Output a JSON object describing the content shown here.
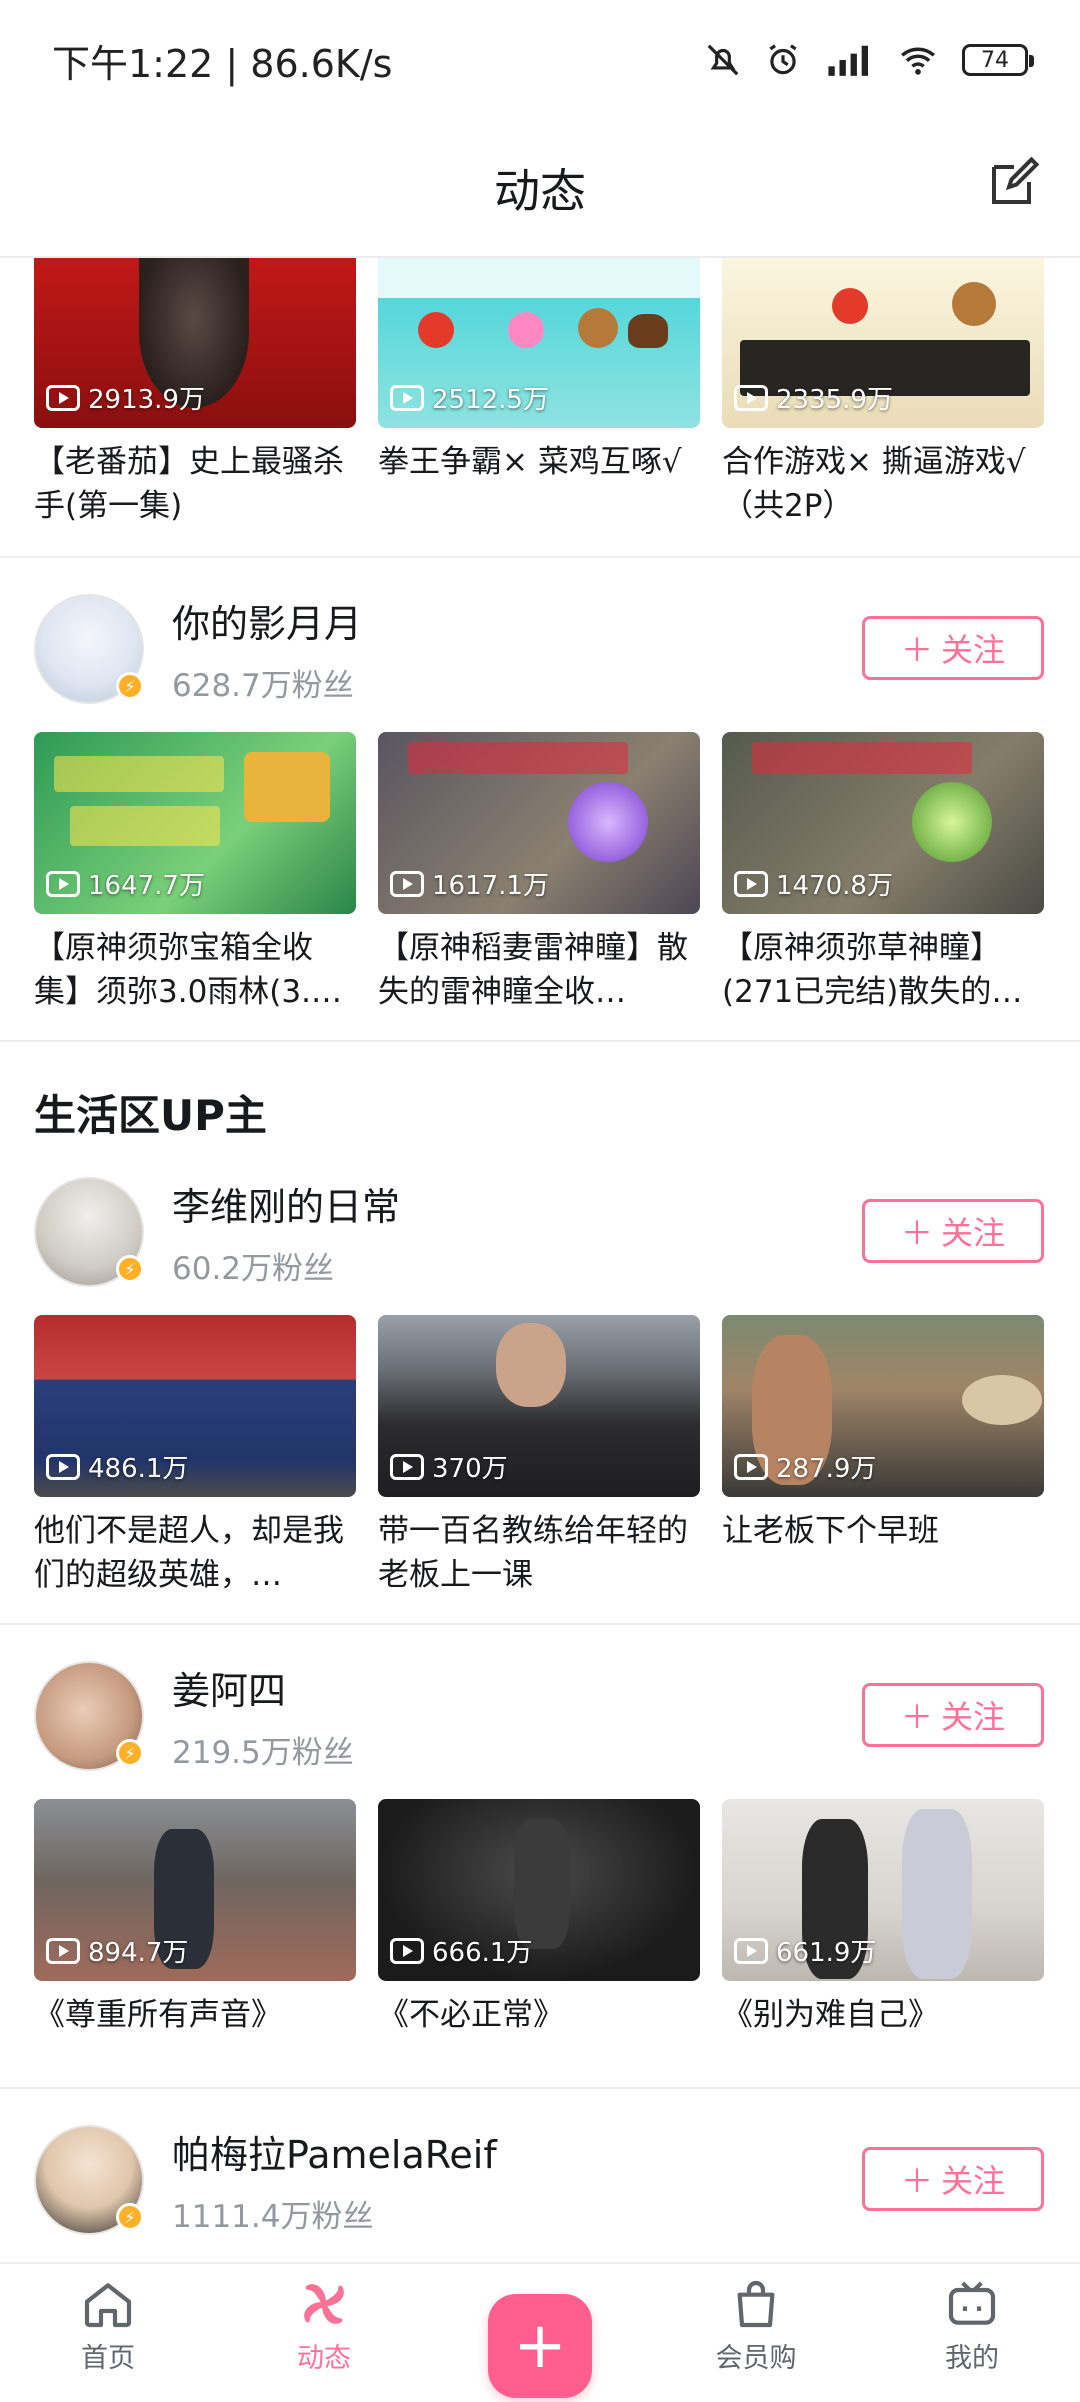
{
  "status": {
    "time_speed": "下午1:22 | 86.6K/s",
    "battery": "74"
  },
  "header": {
    "title": "动态"
  },
  "top_videos": [
    {
      "views": "2913.9万",
      "title": "【老番茄】史上最骚杀手(第一集)"
    },
    {
      "views": "2512.5万",
      "title": "拳王争霸× 菜鸡互啄√"
    },
    {
      "views": "2335.9万",
      "title": "合作游戏× 撕逼游戏√（共2P）"
    }
  ],
  "ups": [
    {
      "name": "你的影月月",
      "fans": "628.7万粉丝",
      "follow": "关注",
      "videos": [
        {
          "views": "1647.7万",
          "title": "【原神须弥宝箱全收集】须弥3.0雨林(3.…"
        },
        {
          "views": "1617.1万",
          "title": "【原神稻妻雷神瞳】散失的雷神瞳全收…"
        },
        {
          "views": "1470.8万",
          "title": "【原神须弥草神瞳】(271已完结)散失的…"
        }
      ]
    }
  ],
  "section_life": "生活区UP主",
  "life_ups": [
    {
      "name": "李维刚的日常",
      "fans": "60.2万粉丝",
      "follow": "关注",
      "videos": [
        {
          "views": "486.1万",
          "title": "他们不是超人，却是我们的超级英雄，…"
        },
        {
          "views": "370万",
          "title": "带一百名教练给年轻的老板上一课"
        },
        {
          "views": "287.9万",
          "title": "让老板下个早班"
        }
      ]
    },
    {
      "name": "姜阿四",
      "fans": "219.5万粉丝",
      "follow": "关注",
      "videos": [
        {
          "views": "894.7万",
          "title": "《尊重所有声音》"
        },
        {
          "views": "666.1万",
          "title": "《不必正常》"
        },
        {
          "views": "661.9万",
          "title": "《别为难自己》"
        }
      ]
    },
    {
      "name": "帕梅拉PamelaReif",
      "fans": "1111.4万粉丝",
      "follow": "关注"
    }
  ],
  "nav": {
    "home": "首页",
    "dynamic": "动态",
    "vip": "会员购",
    "mine": "我的"
  },
  "colors": {
    "accent": "#fb7299"
  }
}
